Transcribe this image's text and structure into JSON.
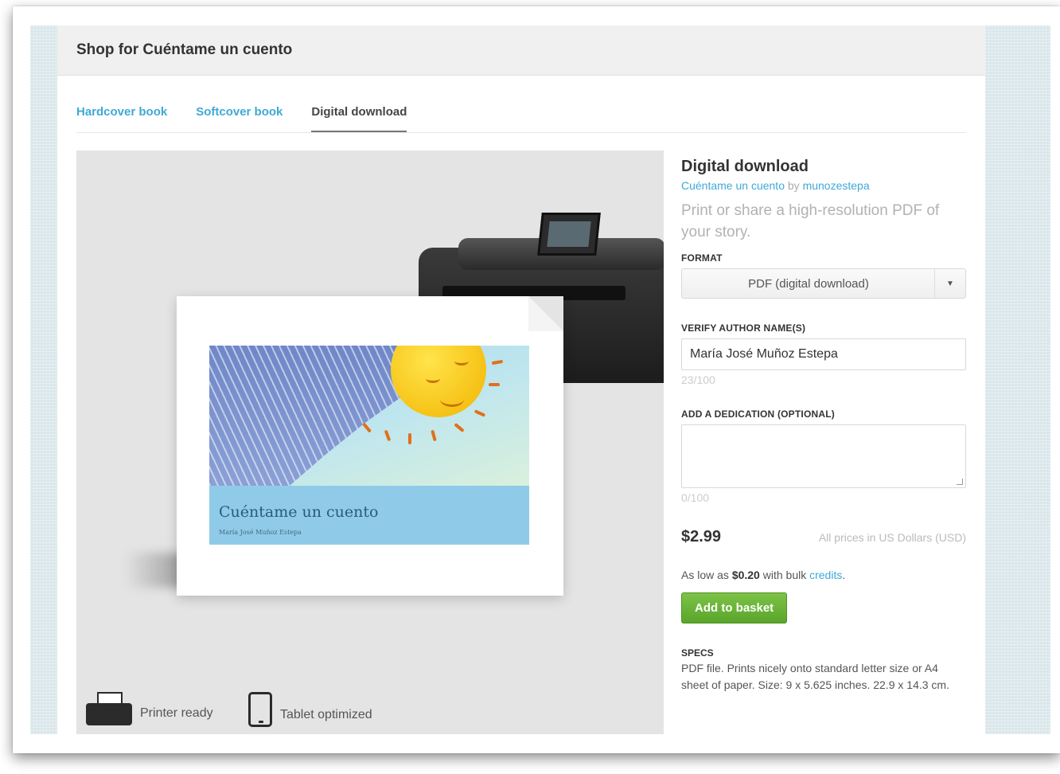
{
  "header": {
    "title": "Shop for Cuéntame un cuento"
  },
  "tabs": [
    {
      "label": "Hardcover book",
      "active": false
    },
    {
      "label": "Softcover book",
      "active": false
    },
    {
      "label": "Digital download",
      "active": true
    }
  ],
  "preview": {
    "book_title": "Cuéntame un cuento",
    "book_author": "María José Muñoz Estepa",
    "badges": [
      {
        "icon": "printer-icon",
        "label": "Printer ready"
      },
      {
        "icon": "tablet-icon",
        "label": "Tablet optimized"
      }
    ]
  },
  "product": {
    "heading": "Digital download",
    "story_link": "Cuéntame un cuento",
    "by_text": "by",
    "author_link": "munozestepa",
    "description": "Print or share a high-resolution PDF of your story."
  },
  "format": {
    "label": "FORMAT",
    "selected": "PDF (digital download)"
  },
  "author_name": {
    "label": "VERIFY AUTHOR NAME(S)",
    "value": "María José Muñoz Estepa",
    "counter": "23/100"
  },
  "dedication": {
    "label": "ADD A DEDICATION (OPTIONAL)",
    "value": "",
    "counter": "0/100"
  },
  "pricing": {
    "price": "$2.99",
    "note": "All prices in US Dollars (USD)",
    "bulk_prefix": "As low as",
    "bulk_price": "$0.20",
    "bulk_middle": "with bulk",
    "bulk_link": "credits",
    "bulk_suffix": "."
  },
  "actions": {
    "add_to_basket": "Add to basket"
  },
  "specs": {
    "label": "SPECS",
    "text": "PDF file. Prints nicely onto standard letter size or A4 sheet of paper. Size: 9 x 5.625 inches. 22.9 x 14.3 cm."
  },
  "colors": {
    "accent": "#3fa9d6",
    "button": "#5aa52a",
    "header_bg": "#f0f0f0",
    "backdrop": "#d9e6ea"
  }
}
